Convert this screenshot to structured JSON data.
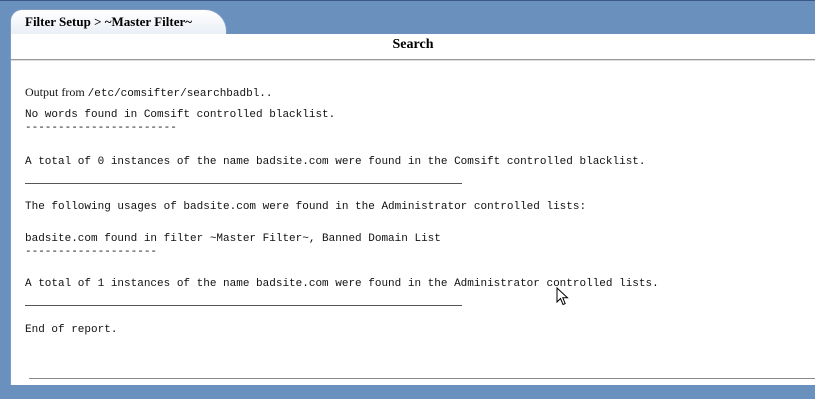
{
  "tab": {
    "label": "Filter Setup > ~Master Filter~"
  },
  "panel": {
    "title": "Search"
  },
  "report": {
    "output_prefix": "Output from ",
    "output_path": "/etc/comsifter/searchbadbl..",
    "line_no_words": "No words found in Comsift controlled blacklist.",
    "dashes_1": "-----------------------",
    "line_total_comsift": "A total of 0 instances of the name badsite.com were found in the Comsift controlled blacklist.",
    "line_admin_usages": "The following usages of badsite.com were found in the Administrator controlled lists:",
    "line_found_in_filter": "badsite.com found in filter ~Master Filter~, Banned Domain List",
    "dashes_2": "--------------------",
    "line_total_admin": "A total of 1 instances of the name badsite.com were found in the Administrator controlled lists.",
    "line_end": "End of report."
  },
  "icons": {
    "cursor": "mouse-pointer-icon"
  },
  "colors": {
    "frame": "#6a90bd",
    "panel": "#ffffff",
    "tab": "#ffffff"
  }
}
